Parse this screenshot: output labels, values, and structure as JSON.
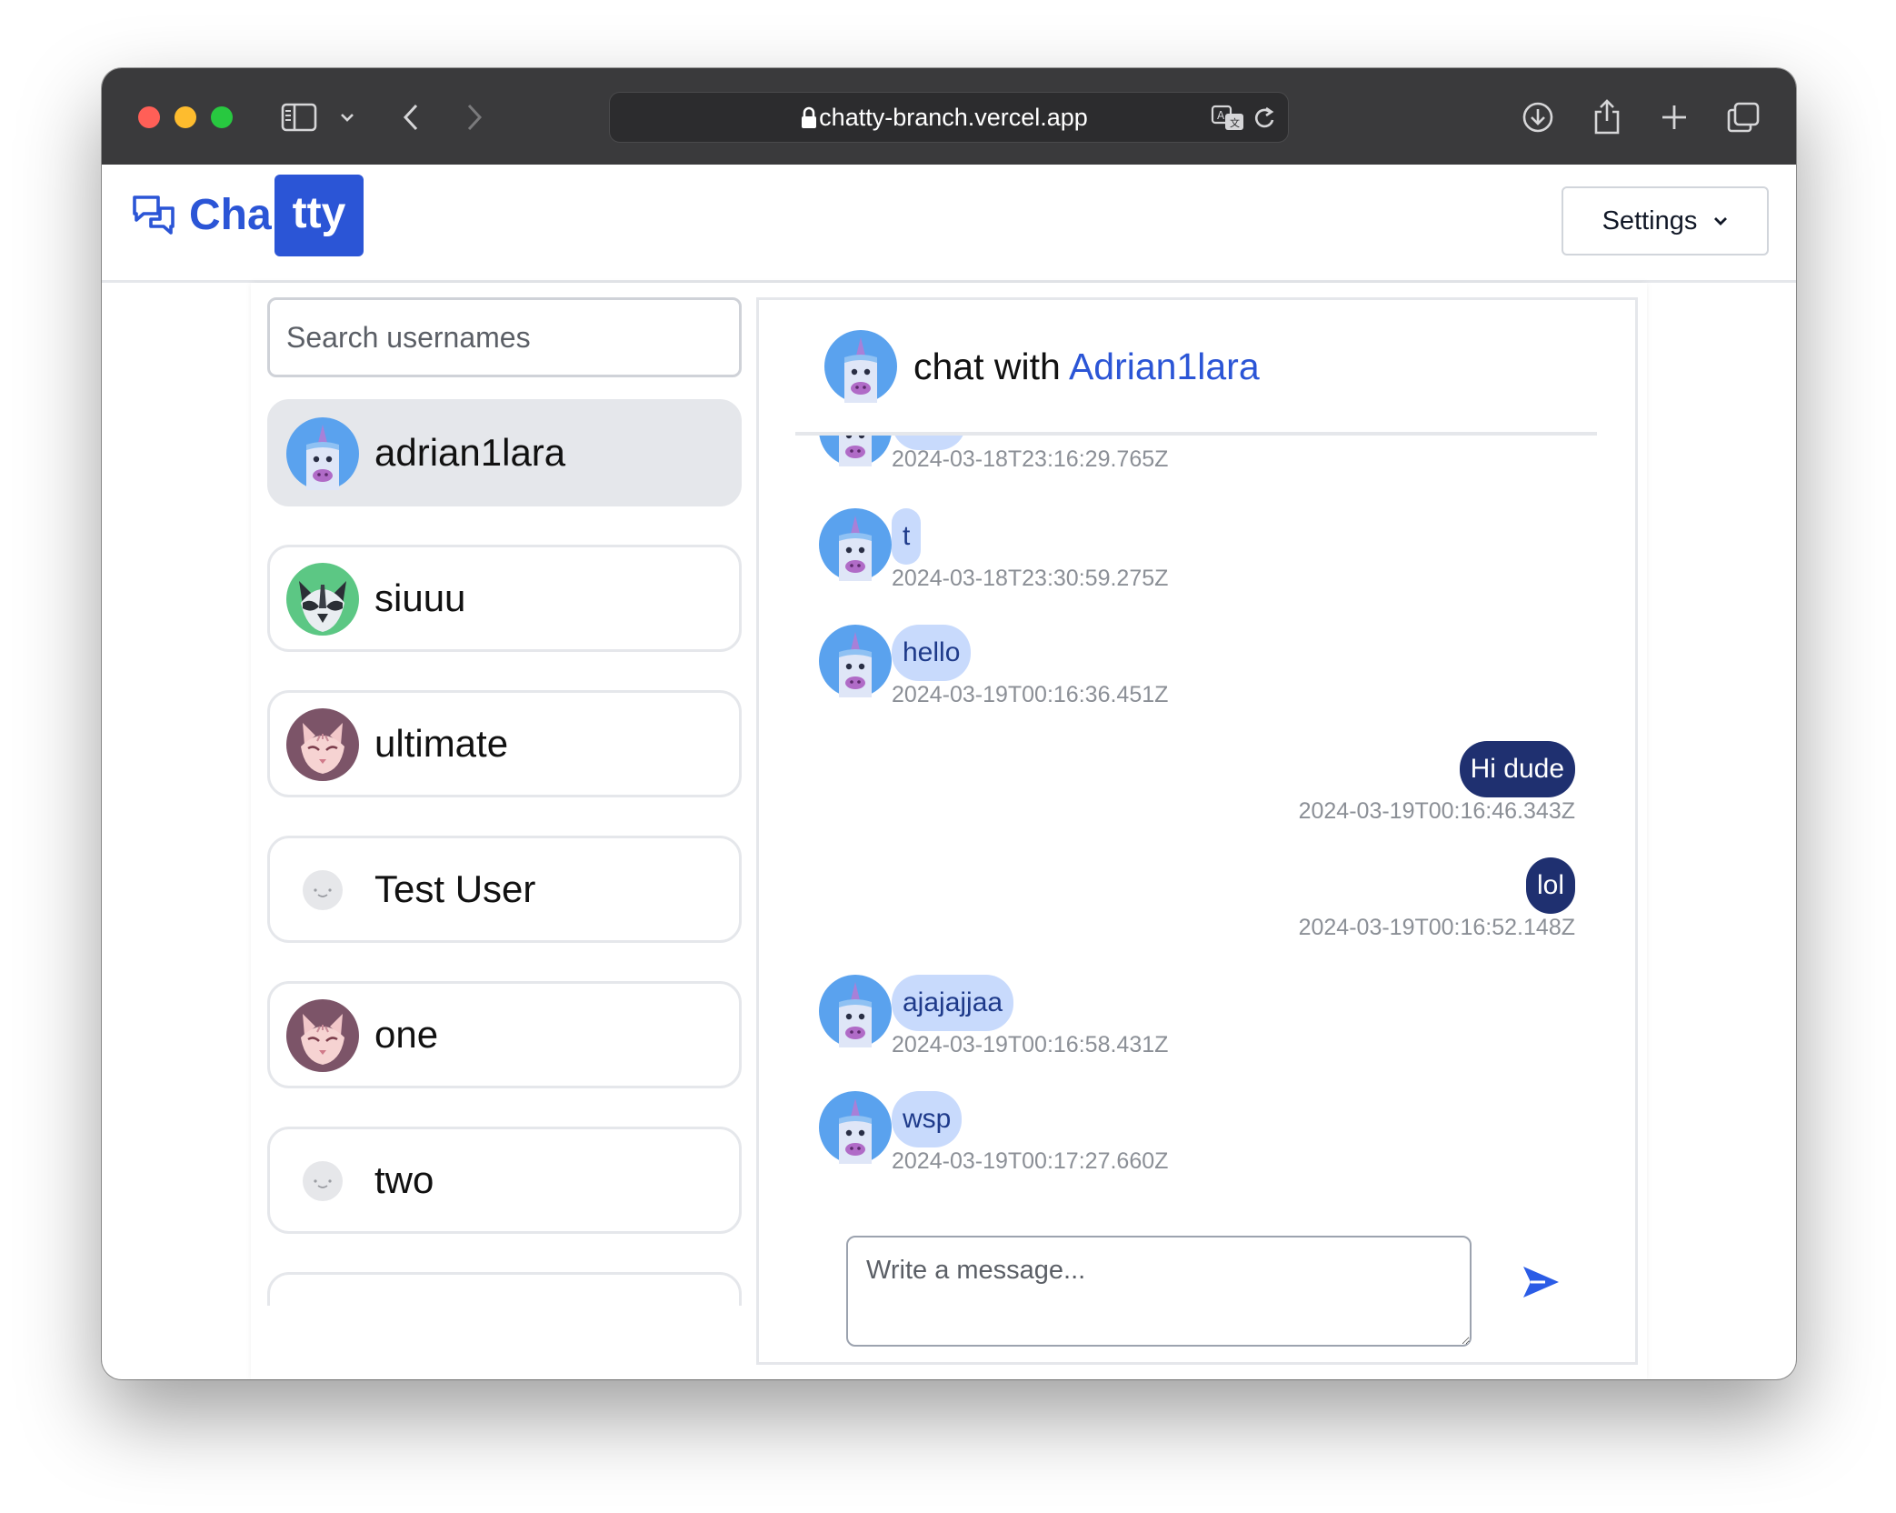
{
  "browser": {
    "url": "chatty-branch.vercel.app"
  },
  "app": {
    "logo_part1": "Cha",
    "logo_part2": "tty",
    "settings_label": "Settings",
    "accent": "#2b55d6"
  },
  "sidebar": {
    "search_placeholder": "Search usernames",
    "users": [
      {
        "name": "adrian1lara",
        "avatar": "unicorn-avatar",
        "active": true
      },
      {
        "name": "siuuu",
        "avatar": "raccoon-avatar",
        "active": false
      },
      {
        "name": "ultimate",
        "avatar": "cat-avatar",
        "active": false
      },
      {
        "name": "Test User",
        "avatar": "default-avatar",
        "active": false
      },
      {
        "name": "one",
        "avatar": "cat-avatar",
        "active": false
      },
      {
        "name": "two",
        "avatar": "default-avatar",
        "active": false
      }
    ]
  },
  "chat": {
    "title_prefix": "chat with",
    "title_user": "Adrian1lara",
    "composer_placeholder": "Write a message...",
    "messages": [
      {
        "text": "VAA",
        "time": "2024-03-18T23:16:29.765Z",
        "direction": "in"
      },
      {
        "text": "t",
        "time": "2024-03-18T23:30:59.275Z",
        "direction": "in"
      },
      {
        "text": "hello",
        "time": "2024-03-19T00:16:36.451Z",
        "direction": "in"
      },
      {
        "text": "Hi dude",
        "time": "2024-03-19T00:16:46.343Z",
        "direction": "out"
      },
      {
        "text": "lol",
        "time": "2024-03-19T00:16:52.148Z",
        "direction": "out"
      },
      {
        "text": "ajajajjaa",
        "time": "2024-03-19T00:16:58.431Z",
        "direction": "in"
      },
      {
        "text": "wsp",
        "time": "2024-03-19T00:17:27.660Z",
        "direction": "in"
      }
    ]
  }
}
